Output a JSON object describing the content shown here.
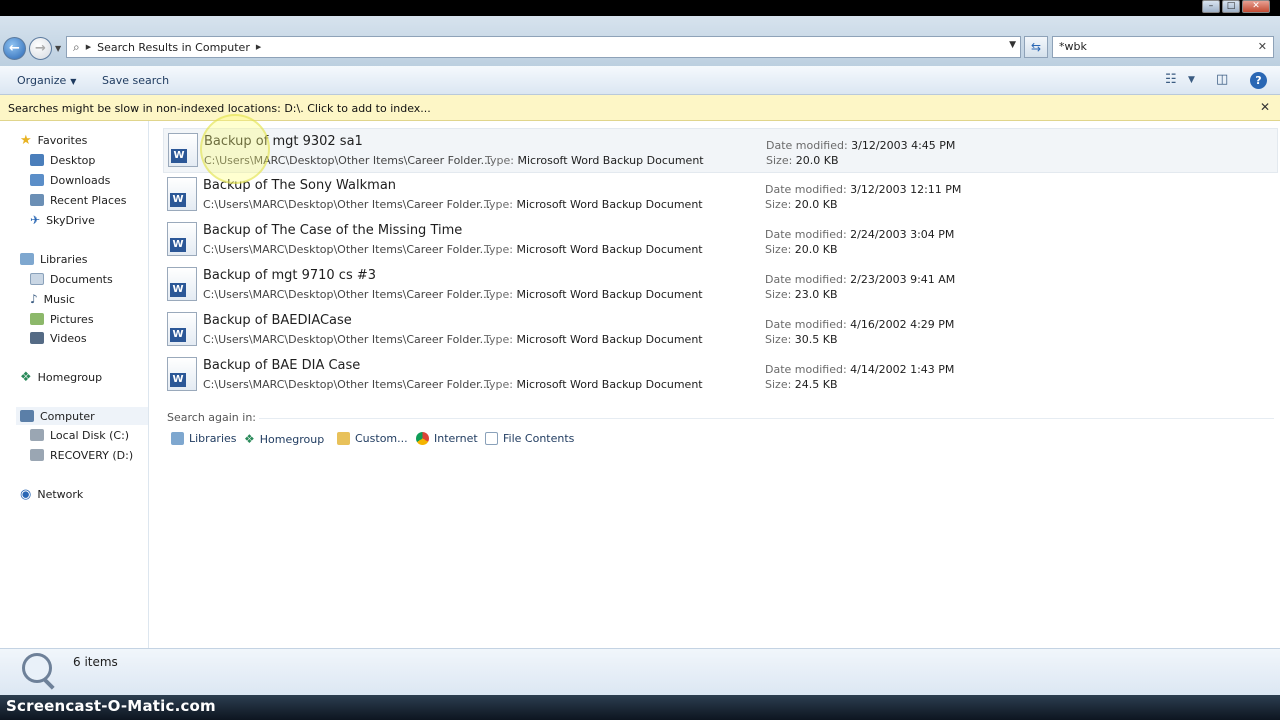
{
  "window_controls": {
    "minimize": "–",
    "maximize": "□",
    "close": "✕"
  },
  "address_bar": {
    "path": "Search Results in Computer",
    "search_value": "*wbk"
  },
  "toolbar": {
    "organize_label": "Organize",
    "save_search_label": "Save search"
  },
  "infobar": {
    "message": "Searches might be slow in non-indexed locations: D:\\. Click to add to index..."
  },
  "sidebar": {
    "favorites": {
      "label": "Favorites",
      "items": [
        "Desktop",
        "Downloads",
        "Recent Places",
        "SkyDrive"
      ]
    },
    "libraries": {
      "label": "Libraries",
      "items": [
        "Documents",
        "Music",
        "Pictures",
        "Videos"
      ]
    },
    "homegroup": {
      "label": "Homegroup"
    },
    "computer": {
      "label": "Computer",
      "items": [
        "Local Disk (C:)",
        "RECOVERY (D:)"
      ]
    },
    "network": {
      "label": "Network"
    }
  },
  "labels": {
    "type": "Type:",
    "date_modified": "Date modified:",
    "size": "Size:"
  },
  "results": [
    {
      "name": "Backup of mgt 9302 sa1",
      "path": "C:\\Users\\MARC\\Desktop\\Other Items\\Career Folder...",
      "type": "Microsoft Word Backup Document",
      "date": "3/12/2003 4:45 PM",
      "size": "20.0 KB"
    },
    {
      "name": "Backup of The Sony Walkman",
      "path": "C:\\Users\\MARC\\Desktop\\Other Items\\Career Folder...",
      "type": "Microsoft Word Backup Document",
      "date": "3/12/2003 12:11 PM",
      "size": "20.0 KB"
    },
    {
      "name": "Backup of The Case of the Missing Time",
      "path": "C:\\Users\\MARC\\Desktop\\Other Items\\Career Folder...",
      "type": "Microsoft Word Backup Document",
      "date": "2/24/2003 3:04 PM",
      "size": "20.0 KB"
    },
    {
      "name": "Backup of mgt 9710 cs #3",
      "path": "C:\\Users\\MARC\\Desktop\\Other Items\\Career Folder...",
      "type": "Microsoft Word Backup Document",
      "date": "2/23/2003 9:41 AM",
      "size": "23.0 KB"
    },
    {
      "name": "Backup of BAEDIACase",
      "path": "C:\\Users\\MARC\\Desktop\\Other Items\\Career Folder...",
      "type": "Microsoft Word Backup Document",
      "date": "4/16/2002 4:29 PM",
      "size": "30.5 KB"
    },
    {
      "name": "Backup of BAE DIA Case",
      "path": "C:\\Users\\MARC\\Desktop\\Other Items\\Career Folder...",
      "type": "Microsoft Word Backup Document",
      "date": "4/14/2002 1:43 PM",
      "size": "24.5 KB"
    }
  ],
  "search_again": {
    "label": "Search again in:",
    "locations": [
      "Libraries",
      "Homegroup",
      "Custom...",
      "Internet",
      "File Contents"
    ]
  },
  "status": {
    "count": "6 items"
  },
  "watermark": "Screencast-O-Matic.com",
  "colors": {
    "accent": "#2a67b4",
    "infobar": "#fdf6c6",
    "word_blue": "#2b5797"
  }
}
